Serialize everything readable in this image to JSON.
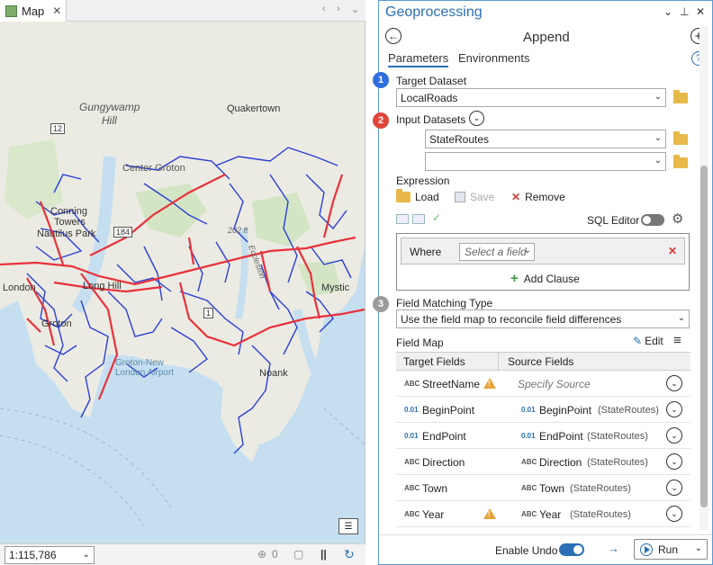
{
  "map": {
    "tab_label": "Map",
    "scale": "1:115,786",
    "status_count": "0",
    "labels": {
      "gungywamp": "Gungywamp",
      "hill": "Hill",
      "quakertown": "Quakertown",
      "route12": "12",
      "center_groton": "Center Groton",
      "conning": "Conning",
      "towers": "Towers",
      "nautilus_park": "Nautilus Park",
      "route184": "184",
      "elev": "202 ft",
      "eccleston": "Eccleston",
      "new_london": "London",
      "long_hill": "Long Hill",
      "groton": "Groton",
      "airport1": "Groton-New",
      "airport2": "London Airport",
      "noank": "Noank",
      "mystic": "Mystic",
      "route1": "1"
    }
  },
  "gp": {
    "title": "Geoprocessing",
    "tool_name": "Append",
    "tabs": [
      "Parameters",
      "Environments"
    ],
    "target_dataset_label": "Target Dataset",
    "target_dataset_value": "LocalRoads",
    "input_datasets_label": "Input Datasets",
    "input_datasets": [
      "StateRoutes",
      ""
    ],
    "expression_label": "Expression",
    "load_label": "Load",
    "save_label": "Save",
    "remove_label": "Remove",
    "sql_editor_label": "SQL Editor",
    "where_label": "Where",
    "field_placeholder": "Select a field",
    "add_clause_label": "Add Clause",
    "field_matching_label": "Field Matching Type",
    "field_matching_value": "Use the field map to reconcile field differences",
    "field_map_label": "Field Map",
    "edit_label": "Edit",
    "col_target": "Target Fields",
    "col_source": "Source Fields",
    "rows": [
      {
        "type": "ABC",
        "target": "StreetName",
        "warn": true,
        "source": "Specify Source",
        "source_table": "",
        "source_type": ""
      },
      {
        "type": "0.01",
        "target": "BeginPoint",
        "warn": false,
        "source": "BeginPoint",
        "source_table": "(StateRoutes)",
        "source_type": "0.01"
      },
      {
        "type": "0.01",
        "target": "EndPoint",
        "warn": false,
        "source": "EndPoint",
        "source_table": "(StateRoutes)",
        "source_type": "0.01"
      },
      {
        "type": "ABC",
        "target": "Direction",
        "warn": false,
        "source": "Direction",
        "source_table": "(StateRoutes)",
        "source_type": "ABC"
      },
      {
        "type": "ABC",
        "target": "Town",
        "warn": false,
        "source": "Town",
        "source_table": "(StateRoutes)",
        "source_type": "ABC"
      },
      {
        "type": "ABC",
        "target": "Year",
        "warn": true,
        "source": "Year",
        "source_table": "(StateRoutes)",
        "source_type": "ABC"
      }
    ],
    "enable_undo_label": "Enable Undo",
    "run_label": "Run",
    "badges": [
      "1",
      "2",
      "3"
    ]
  },
  "colors": {
    "accent": "#2a6fb6",
    "badge1": "#2f6fe0",
    "badge2": "#e0453a",
    "badge3": "#9a9a9a",
    "roads_local": "#2a3fd6",
    "roads_state": "#e8323a"
  }
}
